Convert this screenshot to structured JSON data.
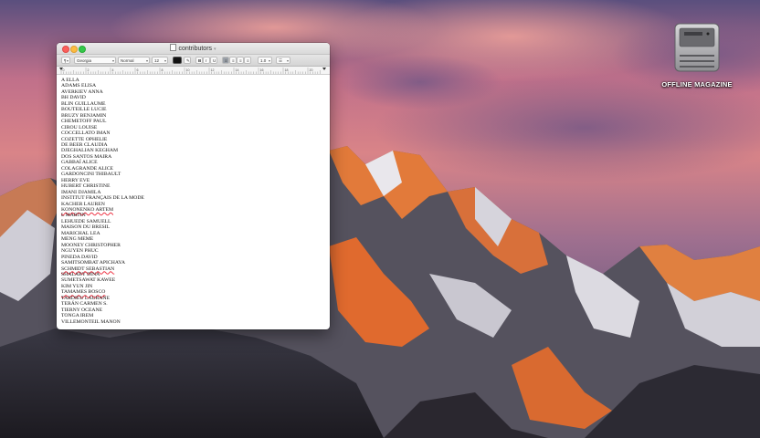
{
  "desktop": {
    "drive_label": "OFFLINE MAGAZINE"
  },
  "window": {
    "title": "contributors",
    "toolbar": {
      "paragraph_style": "¶",
      "font_family": "Georgia",
      "font_style": "Normal",
      "font_size": "12",
      "text_color": "#111111",
      "bold": "B",
      "italic": "I",
      "underline": "U",
      "line_spacing": "1.0",
      "list": "☰"
    },
    "ruler_numbers": [
      "0",
      "2",
      "4",
      "6",
      "8",
      "10",
      "12",
      "14",
      "16",
      "18",
      "20"
    ],
    "lines": [
      "A ELLA",
      "ADAMS ELISA",
      "AVERKIEV ANNA",
      "BH DAVID",
      "BLIN GUILLAUME",
      "BOUTEILLE LUCIE",
      "BRUZY BENJAMIN",
      "CHEMETOFF PAUL",
      "CIROU LOUISE",
      "COCCELLATO IMAN",
      "COZETTE OPHELIE",
      "DE BEER CLAUDIA",
      "DJEGHALIAN KEGHAM",
      "DOS SANTOS MAIRA",
      "GABBAÏ ALICE",
      "COLAGRANDE ALICE",
      "GARDONCINI THIBAULT",
      "HERRY EVE",
      "HUBERT CHRISTINE",
      "IMANI DJAMILA",
      "INSTITUT FRANÇAIS DE LA MODE",
      "KACHER LAUREN",
      "KONONENKO ARTEM",
      "L MARTIN",
      "LEHUEDE SAMUELL",
      "MAISON DU BRESIL",
      "MARICHAL LEA",
      "MENG MEME",
      "MOONEY CHRISTOPHER",
      "NGUYEN PHUC",
      "PINEDA DAVID",
      "SAMITSOMBAT APICHAYA",
      "SCHMIDT SEBASTIAN",
      "SHALABY DINA",
      "SUMETSAWAT KAWEE",
      "KIM YUN JIN",
      "TAMAMES BOSCO",
      "TARDIEU LAURANE",
      "TERÁN CARMEN S.",
      "TIERNY OCEANE",
      "TONGA IREM",
      "VILLEMONTEIL MANON"
    ],
    "spellcheck_lines": [
      22,
      32,
      36
    ]
  }
}
